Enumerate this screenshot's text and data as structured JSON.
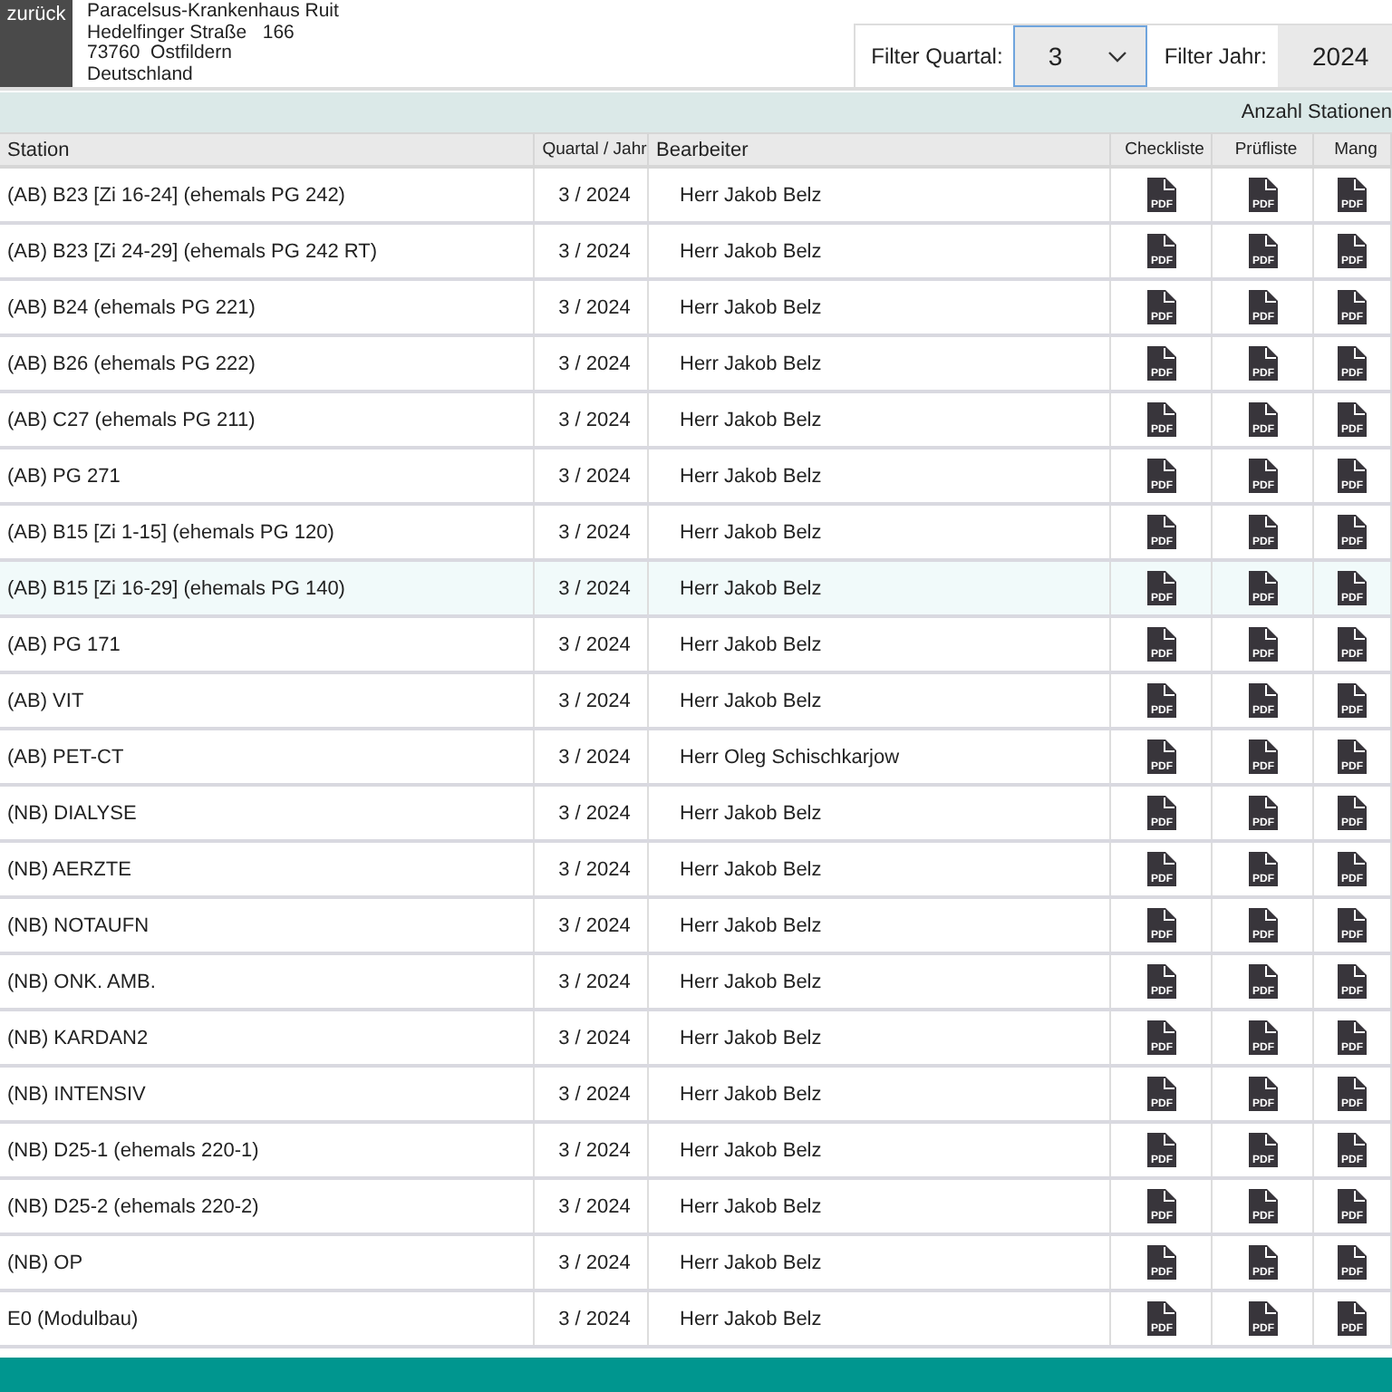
{
  "back_button": {
    "label": "zurück"
  },
  "address": [
    "Paracelsus-Krankenhaus Ruit",
    "Hedelfinger Straße   166",
    "73760  Ostfildern",
    "Deutschland"
  ],
  "filters": [
    {
      "label": "Filter Quartal:",
      "value": "3",
      "kind": "dropdown",
      "focused": true
    },
    {
      "label": "Filter Jahr:",
      "value": "2024",
      "kind": "text",
      "focused": false
    }
  ],
  "summary": "Anzahl Stationen",
  "table": {
    "columns": [
      "Station",
      "Quartal / Jahr",
      "Bearbeiter",
      "Checkliste",
      "Prüfliste",
      "Mang"
    ],
    "rows": [
      {
        "station": "(AB) B23 [Zi 16-24] (ehemals PG 242)",
        "period": "3 / 2024",
        "editor": "Herr Jakob Belz",
        "documents": [
          "PDF",
          "PDF",
          "PDF"
        ],
        "selected": false
      },
      {
        "station": "(AB) B23 [Zi 24-29] (ehemals PG 242 RT)",
        "period": "3 / 2024",
        "editor": "Herr Jakob Belz",
        "documents": [
          "PDF",
          "PDF",
          "PDF"
        ],
        "selected": false
      },
      {
        "station": "(AB) B24 (ehemals PG 221)",
        "period": "3 / 2024",
        "editor": "Herr Jakob Belz",
        "documents": [
          "PDF",
          "PDF",
          "PDF"
        ],
        "selected": false
      },
      {
        "station": "(AB) B26 (ehemals PG 222)",
        "period": "3 / 2024",
        "editor": "Herr Jakob Belz",
        "documents": [
          "PDF",
          "PDF",
          "PDF"
        ],
        "selected": false
      },
      {
        "station": "(AB) C27 (ehemals PG 211)",
        "period": "3 / 2024",
        "editor": "Herr Jakob Belz",
        "documents": [
          "PDF",
          "PDF",
          "PDF"
        ],
        "selected": false
      },
      {
        "station": "(AB) PG 271",
        "period": "3 / 2024",
        "editor": "Herr Jakob Belz",
        "documents": [
          "PDF",
          "PDF",
          "PDF"
        ],
        "selected": false
      },
      {
        "station": "(AB) B15 [Zi 1-15] (ehemals PG 120)",
        "period": "3 / 2024",
        "editor": "Herr Jakob Belz",
        "documents": [
          "PDF",
          "PDF",
          "PDF"
        ],
        "selected": false
      },
      {
        "station": "(AB) B15 [Zi 16-29] (ehemals PG 140)",
        "period": "3 / 2024",
        "editor": "Herr Jakob Belz",
        "documents": [
          "PDF",
          "PDF",
          "PDF"
        ],
        "selected": true
      },
      {
        "station": "(AB) PG 171",
        "period": "3 / 2024",
        "editor": "Herr Jakob Belz",
        "documents": [
          "PDF",
          "PDF",
          "PDF"
        ],
        "selected": false
      },
      {
        "station": "(AB) VIT",
        "period": "3 / 2024",
        "editor": "Herr Jakob Belz",
        "documents": [
          "PDF",
          "PDF",
          "PDF"
        ],
        "selected": false
      },
      {
        "station": "(AB) PET-CT",
        "period": "3 / 2024",
        "editor": "Herr Oleg Schischkarjow",
        "documents": [
          "PDF",
          "PDF",
          "PDF"
        ],
        "selected": false
      },
      {
        "station": "(NB) DIALYSE",
        "period": "3 / 2024",
        "editor": "Herr Jakob Belz",
        "documents": [
          "PDF",
          "PDF",
          "PDF"
        ],
        "selected": false
      },
      {
        "station": "(NB) AERZTE",
        "period": "3 / 2024",
        "editor": "Herr Jakob Belz",
        "documents": [
          "PDF",
          "PDF",
          "PDF"
        ],
        "selected": false
      },
      {
        "station": "(NB) NOTAUFN",
        "period": "3 / 2024",
        "editor": "Herr Jakob Belz",
        "documents": [
          "PDF",
          "PDF",
          "PDF"
        ],
        "selected": false
      },
      {
        "station": "(NB) ONK. AMB.",
        "period": "3 / 2024",
        "editor": "Herr Jakob Belz",
        "documents": [
          "PDF",
          "PDF",
          "PDF"
        ],
        "selected": false
      },
      {
        "station": "(NB) KARDAN2",
        "period": "3 / 2024",
        "editor": "Herr Jakob Belz",
        "documents": [
          "PDF",
          "PDF",
          "PDF"
        ],
        "selected": false
      },
      {
        "station": "(NB) INTENSIV",
        "period": "3 / 2024",
        "editor": "Herr Jakob Belz",
        "documents": [
          "PDF",
          "PDF",
          "PDF"
        ],
        "selected": false
      },
      {
        "station": "(NB) D25-1 (ehemals 220-1)",
        "period": "3 / 2024",
        "editor": "Herr Jakob Belz",
        "documents": [
          "PDF",
          "PDF",
          "PDF"
        ],
        "selected": false
      },
      {
        "station": "(NB) D25-2 (ehemals 220-2)",
        "period": "3 / 2024",
        "editor": "Herr Jakob Belz",
        "documents": [
          "PDF",
          "PDF",
          "PDF"
        ],
        "selected": false
      },
      {
        "station": "(NB) OP",
        "period": "3 / 2024",
        "editor": "Herr Jakob Belz",
        "documents": [
          "PDF",
          "PDF",
          "PDF"
        ],
        "selected": false
      },
      {
        "station": "E0 (Modulbau)",
        "period": "3 / 2024",
        "editor": "Herr Jakob Belz",
        "documents": [
          "PDF",
          "PDF",
          "PDF"
        ],
        "selected": false
      }
    ]
  }
}
